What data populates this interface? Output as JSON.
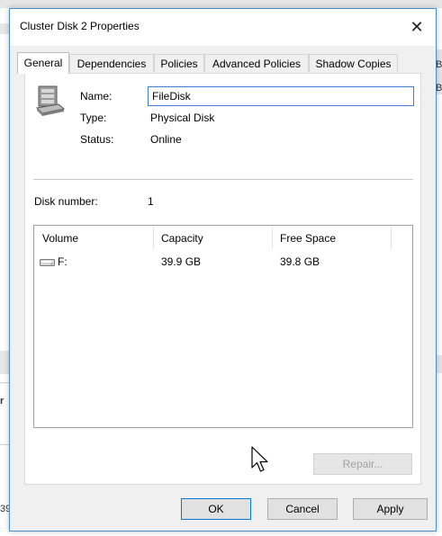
{
  "background": {
    "right_text_1": "B",
    "right_text_2": "B",
    "left_text_1": "r",
    "left_text_2": "39"
  },
  "dialog": {
    "title": "Cluster Disk 2 Properties",
    "close_glyph": "✕"
  },
  "tabs": [
    {
      "label": "General",
      "active": true
    },
    {
      "label": "Dependencies",
      "active": false
    },
    {
      "label": "Policies",
      "active": false
    },
    {
      "label": "Advanced Policies",
      "active": false
    },
    {
      "label": "Shadow Copies",
      "active": false
    }
  ],
  "general": {
    "icon": "disk-drive-icon",
    "name_label": "Name:",
    "name_value": "FileDisk",
    "type_label": "Type:",
    "type_value": "Physical Disk",
    "status_label": "Status:",
    "status_value": "Online",
    "disk_number_label": "Disk number:",
    "disk_number_value": "1"
  },
  "volumes": {
    "columns": [
      "Volume",
      "Capacity",
      "Free Space"
    ],
    "rows": [
      {
        "volume": "F:",
        "capacity": "39.9 GB",
        "free_space": "39.8 GB",
        "icon": "drive-icon"
      }
    ]
  },
  "buttons": {
    "repair": "Repair...",
    "ok": "OK",
    "cancel": "Cancel",
    "apply": "Apply"
  }
}
